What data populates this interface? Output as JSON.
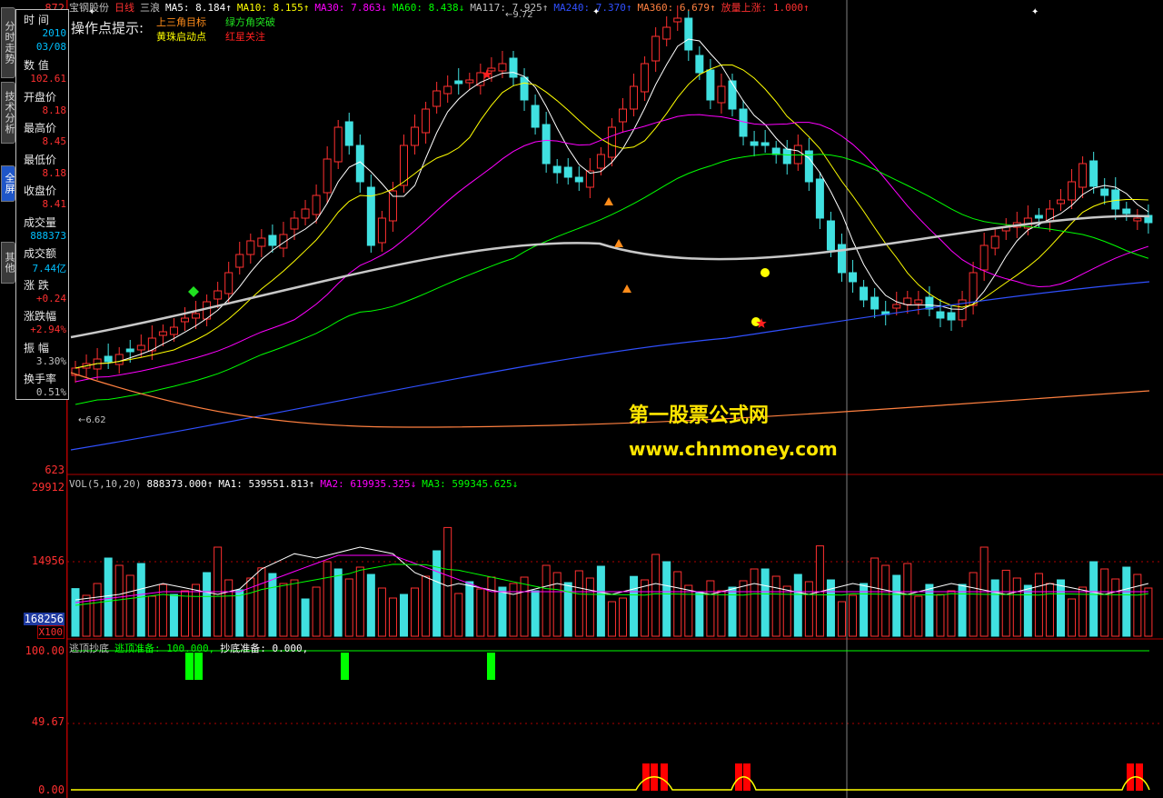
{
  "stock": {
    "name": "宝钢股份",
    "period": "日线",
    "wave": "三浪"
  },
  "ma_header": [
    {
      "label": "MA5: 8.184↑",
      "color": "#ffffff"
    },
    {
      "label": "MA10: 8.155↑",
      "color": "#ffff00"
    },
    {
      "label": "MA30: 7.863↓",
      "color": "#ff00ff"
    },
    {
      "label": "MA60: 8.438↓",
      "color": "#00ff00"
    },
    {
      "label": "MA117: 7.925↑",
      "color": "#c0c0c0"
    },
    {
      "label": "MA240: 7.370↑",
      "color": "#3050ff"
    },
    {
      "label": "MA360: 6.679↑",
      "color": "#ff8040"
    },
    {
      "label": "放量上涨: 1.000↑",
      "color": "#ff3030"
    }
  ],
  "legend": {
    "title": "操作点提示:",
    "items": [
      {
        "label": "上三角目标",
        "color": "#ff8c1a"
      },
      {
        "label": "绿方角突破",
        "color": "#20e020"
      },
      {
        "label": "黄珠启动点",
        "color": "#ffff00"
      },
      {
        "label": "红星关注",
        "color": "#ff2020"
      }
    ]
  },
  "side_tabs": [
    "分时走势",
    "技术分析",
    "全屏",
    "其他"
  ],
  "info": {
    "rows": [
      {
        "k": "时  间",
        "v": "2010",
        "vc": "#00c0ff"
      },
      {
        "k": "",
        "v": "03/08",
        "vc": "#00c0ff"
      },
      {
        "k": "数  值",
        "v": "102.61",
        "vc": "#ff3030"
      },
      {
        "k": "开盘价",
        "v": "8.18",
        "vc": "#ff3030"
      },
      {
        "k": "最高价",
        "v": "8.45",
        "vc": "#ff3030"
      },
      {
        "k": "最低价",
        "v": "8.18",
        "vc": "#ff3030"
      },
      {
        "k": "收盘价",
        "v": "8.41",
        "vc": "#ff3030"
      },
      {
        "k": "成交量",
        "v": "888373",
        "vc": "#00c0ff"
      },
      {
        "k": "成交额",
        "v": "7.44亿",
        "vc": "#00c0ff"
      },
      {
        "k": "涨  跌",
        "v": "+0.24",
        "vc": "#ff3030"
      },
      {
        "k": "涨跌幅",
        "v": "+2.94%",
        "vc": "#ff3030"
      },
      {
        "k": "振  幅",
        "v": "3.30%",
        "vc": "#c0c0c0"
      },
      {
        "k": "换手率",
        "v": "0.51%",
        "vc": "#c0c0c0"
      }
    ]
  },
  "price_axis": {
    "top": "872",
    "bottom": "623"
  },
  "price_annotations": {
    "high": "9.72",
    "low": "6.62"
  },
  "vol_header": [
    {
      "label": "VOL(5,10,20)",
      "color": "#c0c0c0"
    },
    {
      "label": "888373.000↑",
      "color": "#ffffff"
    },
    {
      "label": "MA1: 539551.813↑",
      "color": "#ffffff"
    },
    {
      "label": "MA2: 619935.325↓",
      "color": "#ff00ff"
    },
    {
      "label": "MA3: 599345.625↓",
      "color": "#00ff00"
    }
  ],
  "vol_axis": {
    "max": "29912",
    "mid": "14956",
    "current": "168256",
    "unit": "X100"
  },
  "ind_header": [
    {
      "label": "逃顶抄底",
      "color": "#c0c0c0"
    },
    {
      "label": "逃顶准备: 100.000,",
      "color": "#00ff00"
    },
    {
      "label": "抄底准备: 0.000,",
      "color": "#ffffff"
    }
  ],
  "ind_axis": {
    "top": "100.00",
    "mid": "49.67",
    "bottom": "0.00"
  },
  "watermark": {
    "line1": "第一股票公式网",
    "line2": "www.chnmoney.com"
  },
  "colors": {
    "up": "#ff3030",
    "down": "#40e0e0",
    "grid": "#b00000"
  }
}
